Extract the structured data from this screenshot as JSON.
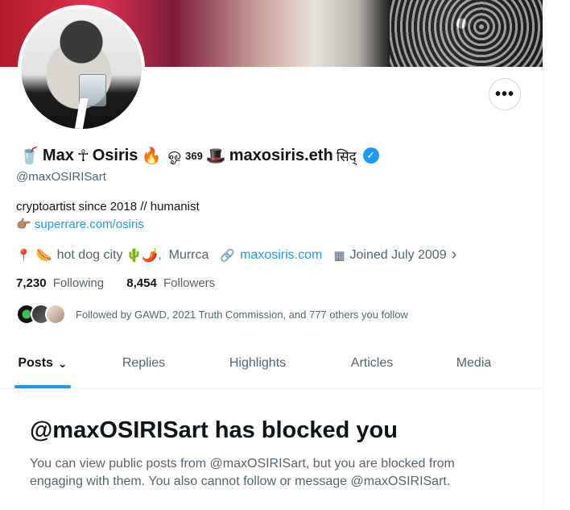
{
  "profile": {
    "name_start": "Max",
    "name_middle": "Osiris",
    "name_sup": "369",
    "name_end": "maxosiris.eth",
    "name_suffix": "सिद्",
    "emoji_1": "🥤",
    "emoji_2": "☥",
    "emoji_3": "🔥",
    "emoji_4": "ஓ",
    "emoji_5": "🎩",
    "verified_icon": "✓",
    "handle": "@maxOSIRISart",
    "bio_line1": "cryptoartist since 2018 // humanist",
    "bio_pointer": "👉🏽",
    "bio_link": "superrare.com/osiris",
    "location_emoji": "🌭",
    "location_text": "hot dog city",
    "location_emoji2": "🌵🌶️",
    "location_suffix": ",  Murrca",
    "website": "maxosiris.com",
    "joined": "Joined July 2009",
    "following_count": "7,230",
    "following_label": "Following",
    "followers_count": "8,454",
    "followers_label": "Followers",
    "followed_by": "Followed by GAWD, 2021 Truth Commission, and 777 others you follow"
  },
  "more_button": "•••",
  "tabs": [
    {
      "label": "Posts"
    },
    {
      "label": "Replies"
    },
    {
      "label": "Highlights"
    },
    {
      "label": "Articles"
    },
    {
      "label": "Media"
    }
  ],
  "blocked": {
    "title": "@maxOSIRISart has blocked you",
    "message": "You can view public posts from @maxOSIRISart, but you are blocked from engaging with them. You also cannot follow or message @maxOSIRISart."
  },
  "icons": {
    "location": "📍",
    "link": "🔗",
    "calendar": "▦",
    "chevron": "›",
    "tab_chevron": "⌄"
  },
  "colors": {
    "accent": "#1d9bf0",
    "secondary_text": "#536471",
    "primary_text": "#0f1419"
  }
}
